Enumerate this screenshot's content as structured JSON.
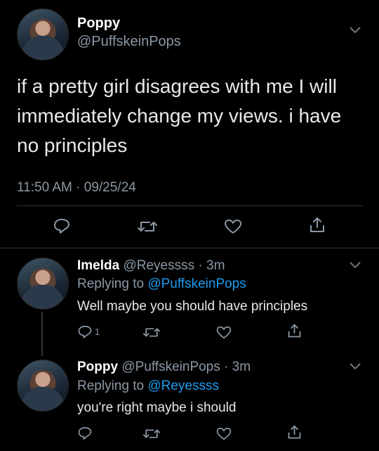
{
  "main_tweet": {
    "name": "Poppy",
    "handle": "@PuffskeinPops",
    "text_line1": "if a pretty girl disagrees with me I will",
    "text_line2": "immediately change my views. i have",
    "text_line3": "no principles",
    "timestamp": "11:50 AM · 09/25/24"
  },
  "reply1": {
    "name": "Imelda",
    "handle": "@Reyessss",
    "time": "· 3m",
    "replying_prefix": "Replying to",
    "replying_to": "@PuffskeinPops",
    "text": "Well maybe you should have principles",
    "reply_count": "1"
  },
  "reply2": {
    "name": "Poppy",
    "handle": "@PuffskeinPops",
    "time": "· 3m",
    "replying_prefix": "Replying to",
    "replying_to": "@Reyessss",
    "text": "you're right maybe i should"
  },
  "icons": [
    "reply-icon",
    "retweet-icon",
    "like-icon",
    "share-icon",
    "chevron-down-icon"
  ]
}
